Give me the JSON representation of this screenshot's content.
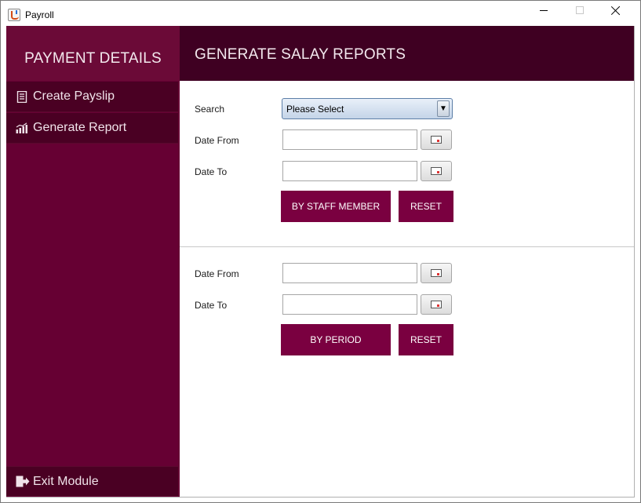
{
  "window": {
    "title": "Payroll"
  },
  "sidebar": {
    "header": "PAYMENT DETAILS",
    "items": [
      {
        "label": "Create Payslip",
        "icon": "document-list-icon"
      },
      {
        "label": "Generate Report",
        "icon": "bar-chart-icon"
      }
    ],
    "exit": {
      "label": "Exit Module",
      "icon": "exit-icon"
    }
  },
  "main": {
    "title": "GENERATE SALAY REPORTS",
    "staff_section": {
      "search_label": "Search",
      "search_value": "Please Select",
      "date_from_label": "Date From",
      "date_to_label": "Date To",
      "submit_label": "BY STAFF MEMBER",
      "reset_label": "RESET"
    },
    "period_section": {
      "date_from_label": "Date From",
      "date_to_label": "Date To",
      "submit_label": "BY PERIOD",
      "reset_label": "RESET"
    }
  },
  "colors": {
    "sidebar_bg": "#660033",
    "sidebar_item_bg": "#4a0023",
    "header_bg": "#3f0022",
    "button_bg": "#7a0040"
  }
}
